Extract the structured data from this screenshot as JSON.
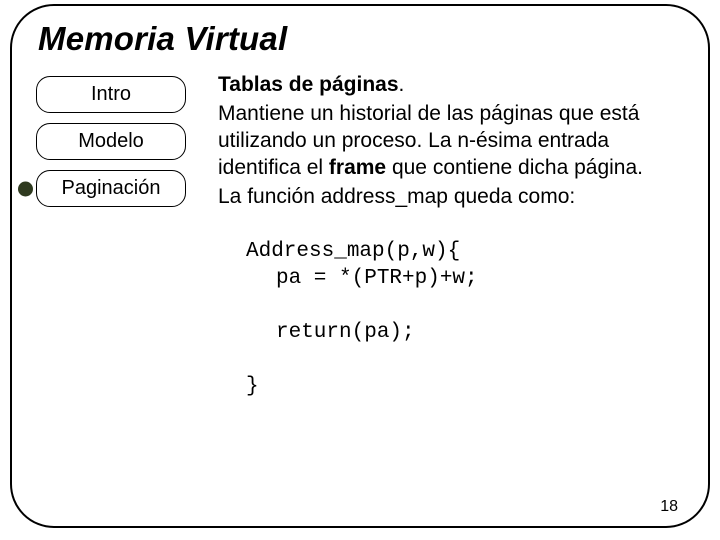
{
  "title": "Memoria Virtual",
  "nav": {
    "items": [
      {
        "label": "Intro",
        "active": false
      },
      {
        "label": "Modelo",
        "active": false
      },
      {
        "label": "Paginación",
        "active": true
      }
    ]
  },
  "content": {
    "heading_bold": "Tablas de páginas",
    "heading_tail": ".",
    "p1a": "Mantiene un historial de las páginas que está utilizando un proceso. La n-ésima entrada identifica el ",
    "p1_bold": "frame",
    "p1b": " que contiene dicha página.",
    "p2": "La función address_map queda como:",
    "code_l1": "Address_map(p,w){",
    "code_l2": "pa = *(PTR+p)+w;",
    "code_l3": "return(pa);",
    "code_l4": "}"
  },
  "page_number": "18"
}
